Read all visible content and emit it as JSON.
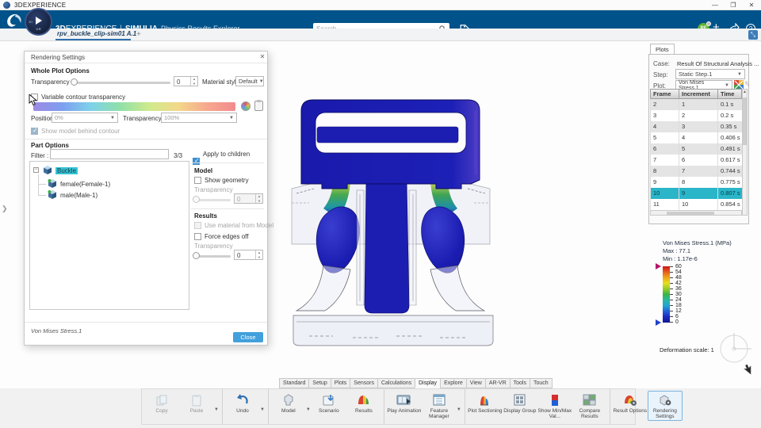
{
  "os_bar": {
    "title": "3DEXPERIENCE",
    "minimize": "—",
    "maximize": "❐",
    "close": "✕"
  },
  "header": {
    "brand_bold": "3D",
    "brand_rest": "EXPERIENCE",
    "pipe": "|",
    "app_bold": "SIMULIA",
    "app_rest": "Physics Results Explorer",
    "search_placeholder": "Search",
    "avatar_initials": "RF",
    "add_label": "+",
    "help_label": "?"
  },
  "tab_bar": {
    "tab_title": "rpv_buckle_clip-sim01 A.1",
    "new_tab": "+"
  },
  "dialog": {
    "title": "Rendering Settings",
    "close_x": "✕",
    "whole_plot_heading": "Whole Plot Options",
    "transparency_label": "Transparency",
    "transparency_value": "0",
    "material_style_label": "Material style",
    "material_style_value": "Default",
    "variable_contour_label": "Variable contour transparency",
    "position_label": "Position",
    "position_value": "0%",
    "contour_transparency_label": "Transparency",
    "contour_transparency_value": "100%",
    "show_model_label": "Show model behind contour",
    "part_options_heading": "Part Options",
    "filter_label": "Filter :",
    "filter_count": "3/3",
    "apply_children_label": "Apply to children",
    "tree": {
      "root_label": "Buckle",
      "child1_label": "female(Female-1)",
      "child2_label": "male(Male-1)"
    },
    "model_heading": "Model",
    "show_geometry_label": "Show geometry",
    "model_transparency_label": "Transparency",
    "model_transparency_value": "0",
    "results_heading": "Results",
    "use_material_label": "Use material from Model",
    "force_edges_label": "Force edges off",
    "results_transparency_label": "Transparency",
    "results_transparency_value": "0",
    "current_plot": "Von Mises Stress.1",
    "close_button": "Close"
  },
  "plots_panel": {
    "tab": "Plots",
    "case_label": "Case:",
    "case_value": "Result Of Structural Analysis ...",
    "step_label": "Step:",
    "step_value": "Static Step.1",
    "plot_label": "Plot:",
    "plot_value": "Von Mises Stress.1",
    "table": {
      "headers": [
        "Frame",
        "Increment",
        "Time"
      ],
      "rows": [
        [
          "2",
          "1",
          "0.1 s"
        ],
        [
          "3",
          "2",
          "0.2 s"
        ],
        [
          "4",
          "3",
          "0.35 s"
        ],
        [
          "5",
          "4",
          "0.406 s"
        ],
        [
          "6",
          "5",
          "0.491 s"
        ],
        [
          "7",
          "6",
          "0.617 s"
        ],
        [
          "8",
          "7",
          "0.744 s"
        ],
        [
          "9",
          "8",
          "0.775 s"
        ],
        [
          "10",
          "9",
          "0.807 s"
        ],
        [
          "11",
          "10",
          "0.854 s"
        ]
      ],
      "selected_frame": "10"
    }
  },
  "legend": {
    "title": "Von Mises Stress.1 (MPa)",
    "max_line": "Max : 77.1",
    "min_line": "Min : 1.17e-6",
    "ticks": [
      "60",
      "54",
      "48",
      "42",
      "36",
      "30",
      "24",
      "18",
      "12",
      "6",
      "0"
    ],
    "deformation_line": "Deformation scale: 1"
  },
  "action_bar": {
    "tabs": [
      "Standard",
      "Setup",
      "Plots",
      "Sensors",
      "Calculations",
      "Display",
      "Explore",
      "View",
      "AR-VR",
      "Tools",
      "Touch"
    ],
    "active_tab": "Display",
    "buttons": {
      "copy": "Copy",
      "paste": "Paste",
      "undo": "Undo",
      "model": "Model",
      "scenario": "Scenario",
      "results": "Results",
      "play_animation": "Play Animation",
      "feature_manager": "Feature Manager",
      "plot_sectioning": "Plot Sectioning",
      "display_group": "Display Group",
      "show_minmax": "Show Min/Max Val...",
      "compare_results": "Compare Results",
      "result_options": "Result Options",
      "rendering_settings": "Rendering Settings"
    }
  },
  "colors": {
    "header_blue": "#00538a",
    "selection_cyan": "#2ab5c8",
    "model_blue": "#1b1db2",
    "close_button_blue": "#42a0dc"
  }
}
